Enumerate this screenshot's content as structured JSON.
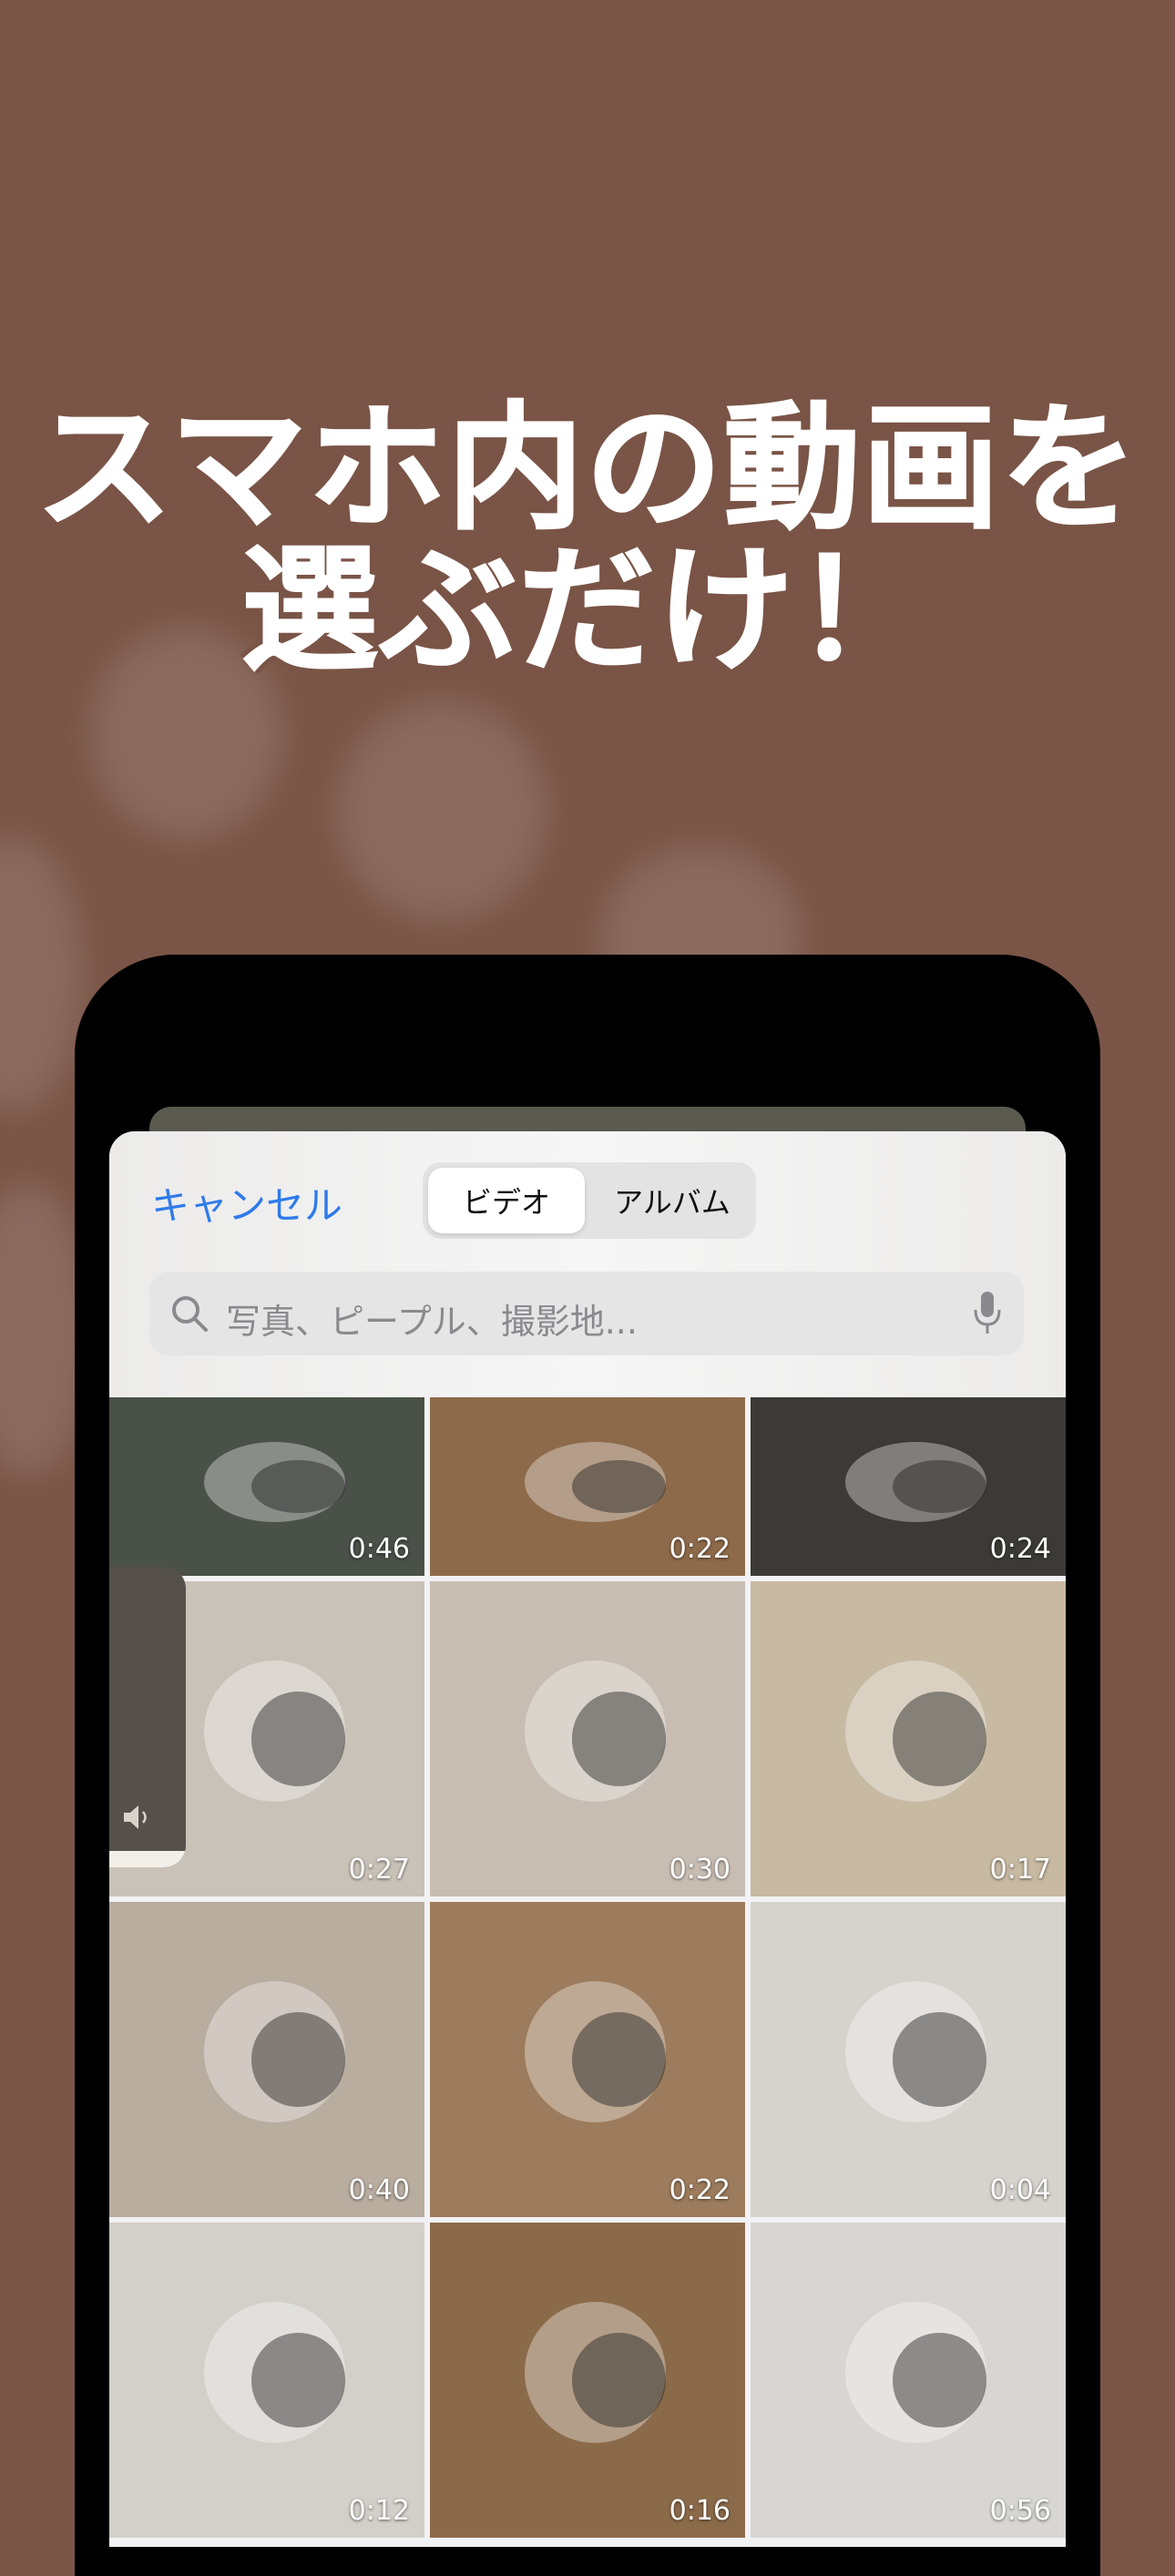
{
  "headline": {
    "line1": "スマホ内の動画を",
    "line2": "選ぶだけ！"
  },
  "picker": {
    "cancel_label": "キャンセル",
    "segments": [
      {
        "label": "ビデオ",
        "selected": true
      },
      {
        "label": "アルバム",
        "selected": false
      }
    ],
    "search_placeholder": "写真、ピープル、撮影地..."
  },
  "videos": [
    {
      "duration": "0:46",
      "color": "#4a5148"
    },
    {
      "duration": "0:22",
      "color": "#8d6a4a"
    },
    {
      "duration": "0:24",
      "color": "#3c3a36"
    },
    {
      "duration": "0:27",
      "color": "#c9c2b8"
    },
    {
      "duration": "0:30",
      "color": "#c8bdb3"
    },
    {
      "duration": "0:17",
      "color": "#c7b9a2"
    },
    {
      "duration": "0:40",
      "color": "#b9ada0"
    },
    {
      "duration": "0:22",
      "color": "#9c7c5c"
    },
    {
      "duration": "0:04",
      "color": "#d6d2cc"
    },
    {
      "duration": "0:12",
      "color": "#d3cfc9"
    },
    {
      "duration": "0:16",
      "color": "#8b6a4a"
    },
    {
      "duration": "0:56",
      "color": "#d8d6d2"
    }
  ]
}
